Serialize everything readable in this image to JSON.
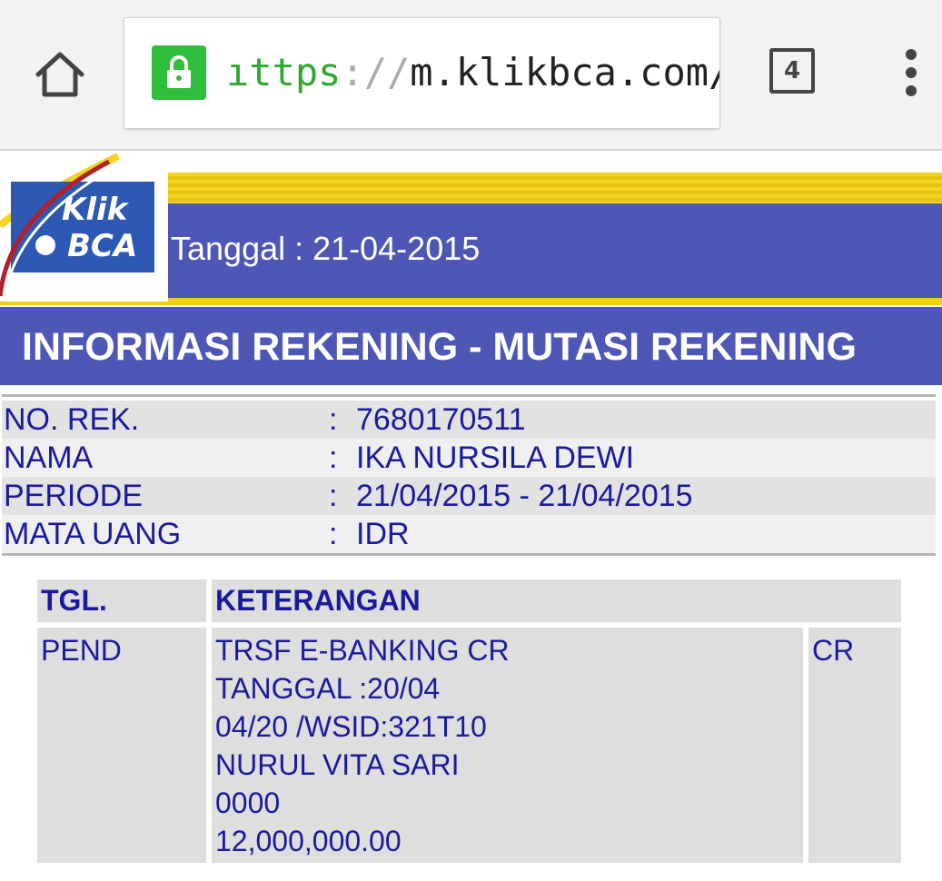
{
  "browser": {
    "url_scheme": "ıttps",
    "url_sep": "://",
    "url_host": "m.klikbca.com/a",
    "tab_count": "4",
    "icons": [
      "home-icon",
      "lock-icon",
      "tab-switcher-icon",
      "more-vert-icon"
    ]
  },
  "header": {
    "logo_line1": "Klik",
    "logo_line2": "BCA",
    "tanggal": "Tanggal : 21-04-2015",
    "title": "INFORMASI REKENING - MUTASI REKENING"
  },
  "account": {
    "rows": [
      {
        "label": "NO. REK.",
        "colon": ":",
        "value": "7680170511"
      },
      {
        "label": "NAMA",
        "colon": ":",
        "value": "IKA NURSILA DEWI"
      },
      {
        "label": "PERIODE",
        "colon": ":",
        "value": "21/04/2015 - 21/04/2015"
      },
      {
        "label": "MATA UANG",
        "colon": ":",
        "value": "IDR"
      }
    ]
  },
  "table": {
    "headers": {
      "tgl": "TGL.",
      "keterangan": "KETERANGAN"
    },
    "rows": [
      {
        "tgl": "PEND",
        "keterangan": [
          "TRSF E-BANKING CR",
          "TANGGAL :20/04",
          "04/20 /WSID:321T10",
          "NURUL VITA SARI",
          "0000",
          "12,000,000.00"
        ],
        "type": "CR"
      }
    ]
  },
  "colors": {
    "brand_blue": "#4f57b6",
    "brand_yellow": "#f0cf15",
    "text_blue": "#1a1aa0",
    "lock_green": "#2fbf3d"
  }
}
